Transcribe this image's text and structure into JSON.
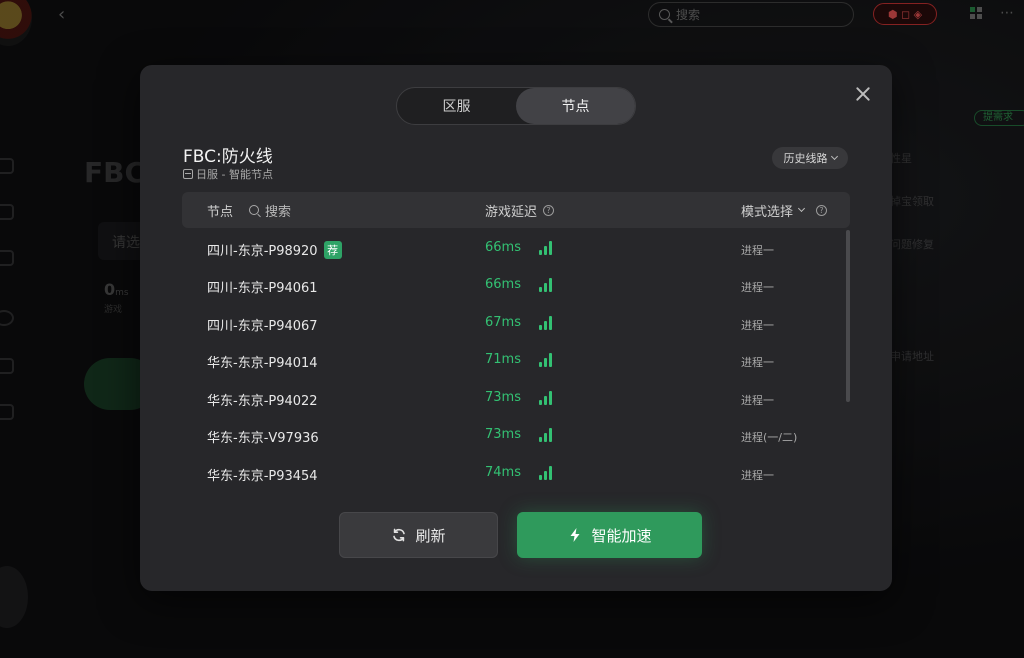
{
  "background": {
    "search_placeholder": "搜索",
    "title_fragment": "FBC:",
    "panel_fragment": "请选",
    "ms_value": "0",
    "ms_unit": "ms",
    "ms_sub": "游戏",
    "right_tag": "提需求",
    "right_texts": [
      "性星",
      "掉宝领取",
      "问题修复",
      "申请地址"
    ]
  },
  "modal": {
    "tabs": [
      {
        "label": "区服",
        "active": false
      },
      {
        "label": "节点",
        "active": true
      }
    ],
    "game_title": "FBC:防火线",
    "game_subtitle": "日服 - 智能节点",
    "history_label": "历史线路",
    "table": {
      "col_node": "节点",
      "search_placeholder": "搜索",
      "col_latency": "游戏延迟",
      "col_mode": "模式选择"
    },
    "rows": [
      {
        "name": "四川-东京-P98920",
        "recommended": true,
        "badge": "荐",
        "latency": "66ms",
        "mode": "进程一"
      },
      {
        "name": "四川-东京-P94061",
        "recommended": false,
        "latency": "66ms",
        "mode": "进程一"
      },
      {
        "name": "四川-东京-P94067",
        "recommended": false,
        "latency": "67ms",
        "mode": "进程一"
      },
      {
        "name": "华东-东京-P94014",
        "recommended": false,
        "latency": "71ms",
        "mode": "进程一"
      },
      {
        "name": "华东-东京-P94022",
        "recommended": false,
        "latency": "73ms",
        "mode": "进程一"
      },
      {
        "name": "华东-东京-V97936",
        "recommended": false,
        "latency": "73ms",
        "mode": "进程(一/二)"
      },
      {
        "name": "华东-东京-P93454",
        "recommended": false,
        "latency": "74ms",
        "mode": "进程一"
      }
    ],
    "refresh_label": "刷新",
    "accelerate_label": "智能加速"
  },
  "colors": {
    "accent": "#2f9a5c",
    "latency_green": "#33c173",
    "modal_bg": "#27272a"
  }
}
